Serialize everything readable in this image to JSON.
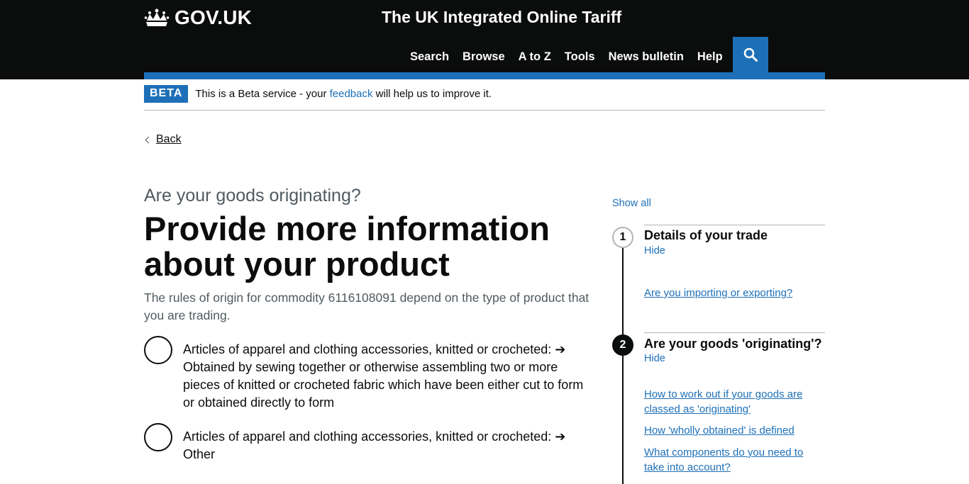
{
  "header": {
    "logo_text": "GOV.UK",
    "service_name": "The UK Integrated Online Tariff",
    "nav": [
      "Search",
      "Browse",
      "A to Z",
      "Tools",
      "News bulletin",
      "Help"
    ],
    "search_icon": "search-icon",
    "colors": {
      "background": "#0b0c0c",
      "accent": "#1d70b8"
    }
  },
  "beta": {
    "tag": "BETA",
    "text_before": "This is a Beta service - your ",
    "link": "feedback",
    "text_after": " will help us to improve it."
  },
  "back_link": "Back",
  "main": {
    "caption": "Are your goods originating?",
    "title": "Provide more information about your product",
    "lead": "The rules of origin for commodity 6116108091 depend on the type of product that you are trading.",
    "options": [
      "Articles of apparel and clothing accessories, knitted or crocheted: ➔ Obtained by sewing together or otherwise assembling two or more pieces of knitted or crocheted fabric which have been either cut to form or obtained directly to form",
      "Articles of apparel and clothing accessories, knitted or crocheted: ➔ Other"
    ]
  },
  "sidebar": {
    "show_all": "Show all",
    "steps": [
      {
        "number": "1",
        "title": "Details of your trade",
        "toggle": "Hide",
        "links": [
          "Are you importing or exporting?"
        ]
      },
      {
        "number": "2",
        "title": "Are your goods 'originating'?",
        "toggle": "Hide",
        "links": [
          "How to work out if your goods are classed as 'originating'",
          "How 'wholly obtained' is defined",
          "What components do you need to take into account?"
        ]
      }
    ]
  }
}
